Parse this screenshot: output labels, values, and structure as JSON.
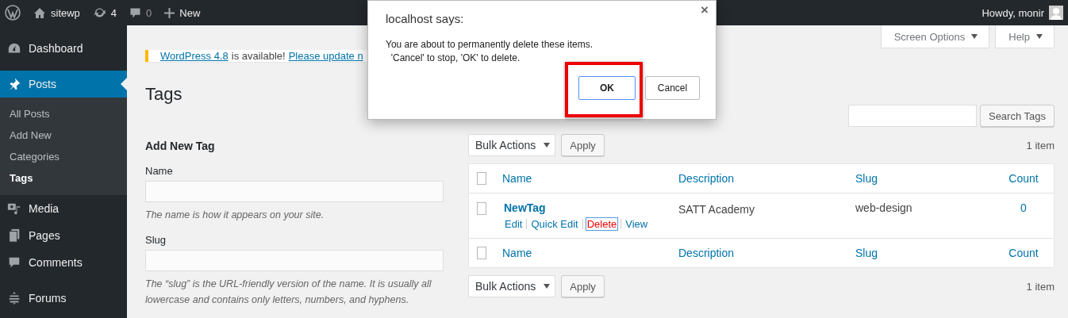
{
  "admin_bar": {
    "site": "sitewp",
    "updates": "4",
    "comments": "0",
    "new": "New",
    "greeting": "Howdy, monir"
  },
  "sidebar": {
    "items": [
      {
        "label": "Dashboard",
        "kind": "dashboard",
        "selected": false
      },
      {
        "label": "Posts",
        "kind": "posts",
        "selected": true,
        "children": [
          {
            "label": "All Posts",
            "selected": false
          },
          {
            "label": "Add New",
            "selected": false
          },
          {
            "label": "Categories",
            "selected": false
          },
          {
            "label": "Tags",
            "selected": true
          }
        ]
      },
      {
        "label": "Media",
        "kind": "media",
        "selected": false
      },
      {
        "label": "Pages",
        "kind": "pages",
        "selected": false
      },
      {
        "label": "Comments",
        "kind": "comments",
        "selected": false
      },
      {
        "label": "Forums",
        "kind": "forums",
        "selected": false
      }
    ]
  },
  "screen_tabs": [
    "Screen Options",
    "Help"
  ],
  "notice": {
    "link": "WordPress 4.8",
    "text": "is available!",
    "link2": "Please update n"
  },
  "title": "Tags",
  "search": {
    "button": "Search Tags"
  },
  "form": {
    "heading": "Add New Tag",
    "fields": [
      {
        "label": "Name",
        "help": "The name is how it appears on your site."
      },
      {
        "label": "Slug",
        "help": "The “slug” is the URL-friendly version of the name. It is usually all lowercase and contains only letters, numbers, and hyphens."
      }
    ]
  },
  "table": {
    "top_nav": {
      "bulk": "Bulk Actions",
      "apply": "Apply",
      "count": "1 item"
    },
    "header": {
      "checked": false,
      "columns": [
        "Name",
        "Description",
        "Slug",
        "Count"
      ]
    },
    "footer": {
      "checked": false,
      "columns": [
        "Name",
        "Description",
        "Slug",
        "Count"
      ]
    },
    "bottom_nav": {
      "bulk": "Bulk Actions",
      "apply": "Apply",
      "count": "1 item"
    },
    "rows": [
      {
        "checked": false,
        "name": "NewTag",
        "description": "SATT Academy",
        "slug": "web-design",
        "count": "0",
        "actions": [
          {
            "label": "Edit",
            "kind": "normal",
            "focused": false
          },
          {
            "label": "Quick Edit",
            "kind": "normal",
            "focused": false
          },
          {
            "label": "Delete",
            "kind": "danger",
            "focused": true
          },
          {
            "label": "View",
            "kind": "normal",
            "focused": false
          }
        ]
      }
    ]
  },
  "dialog": {
    "title": "localhost says:",
    "close": "×",
    "message": [
      "You are about to permanently delete these items.",
      "'Cancel' to stop, 'OK' to delete."
    ],
    "buttons": [
      {
        "label": "OK",
        "selected": true
      },
      {
        "label": "Cancel",
        "selected": false
      }
    ]
  }
}
